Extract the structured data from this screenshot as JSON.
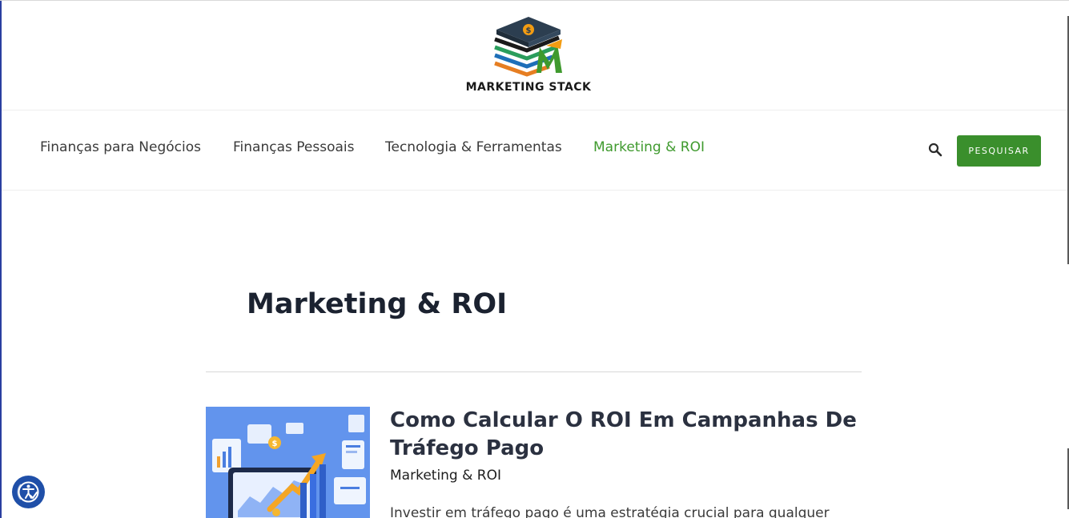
{
  "brand": {
    "name": "MARKETING STACK",
    "logo_icon": "books-stack-dollar-logo",
    "colors": {
      "accent_green": "#3f9a2e",
      "button_green": "#3a8f2c",
      "a11y_blue": "#1f4fa8"
    }
  },
  "nav": {
    "items": [
      {
        "label": "Finanças para Negócios",
        "active": false
      },
      {
        "label": "Finanças Pessoais",
        "active": false
      },
      {
        "label": "Tecnologia & Ferramentas",
        "active": false
      },
      {
        "label": "Marketing & ROI",
        "active": true
      }
    ],
    "search_icon": "search-icon",
    "search_button_label": "PESQUISAR"
  },
  "archive": {
    "title": "Marketing & ROI"
  },
  "posts": [
    {
      "title": "Como Calcular O ROI Em Campanhas De Tráfego Pago",
      "category": "Marketing & ROI",
      "excerpt": "Investir em tráfego pago é uma estratégia crucial para qualquer",
      "thumbnail_icon": "analytics-illustration"
    }
  ],
  "accessibility": {
    "icon": "accessibility-icon"
  }
}
